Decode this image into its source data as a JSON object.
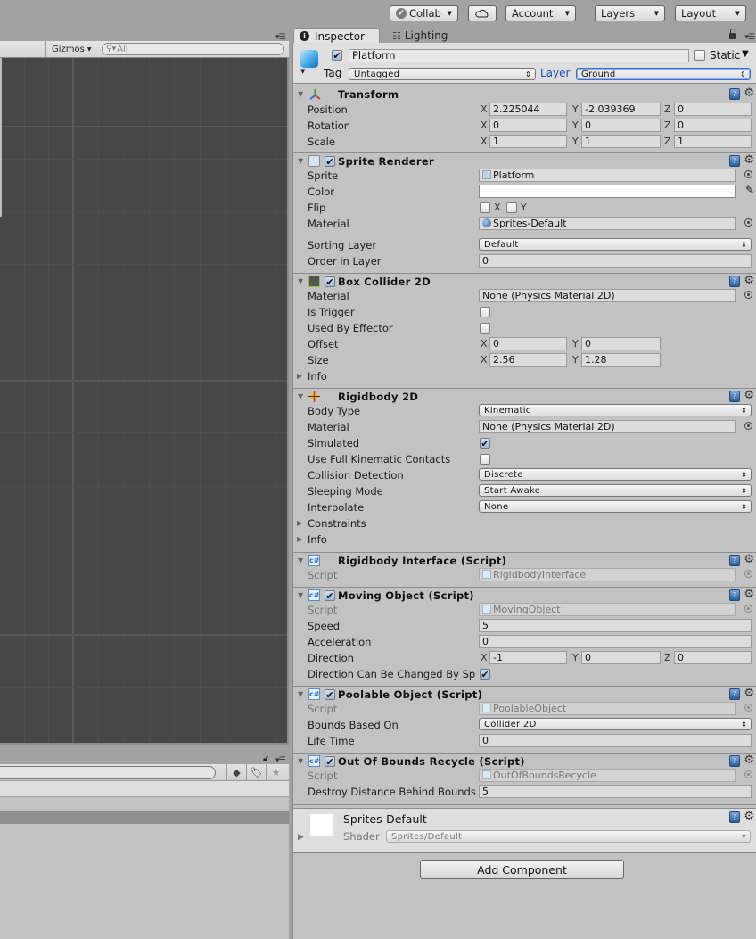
{
  "toolbar": {
    "collab_label": "Collab",
    "cloud_icon": "cloud-icon",
    "account_label": "Account",
    "layers_label": "Layers",
    "layout_label": "Layout"
  },
  "scene": {
    "gizmos_label": "Gizmos",
    "search_placeholder": "All"
  },
  "project": {
    "search_value": "",
    "icons": [
      "filter-by-type-icon",
      "filter-by-label-icon",
      "favorites-star-icon"
    ]
  },
  "inspector": {
    "tabs": [
      {
        "label": "Inspector",
        "icon": "info-icon",
        "active": true
      },
      {
        "label": "Lighting",
        "icon": "lighting-icon",
        "active": false
      }
    ],
    "gameobject": {
      "active": true,
      "name": "Platform",
      "static_label": "Static",
      "static": false,
      "tag_label": "Tag",
      "tag": "Untagged",
      "layer_label": "Layer",
      "layer": "Ground"
    },
    "transform": {
      "title": "Transform",
      "position_label": "Position",
      "rotation_label": "Rotation",
      "scale_label": "Scale",
      "position": {
        "x": "2.225044",
        "y": "-2.039369",
        "z": "0"
      },
      "rotation": {
        "x": "0",
        "y": "0",
        "z": "0"
      },
      "scale": {
        "x": "1",
        "y": "1",
        "z": "1"
      }
    },
    "sprite_renderer": {
      "title": "Sprite Renderer",
      "enabled": true,
      "sprite_label": "Sprite",
      "sprite": "Platform",
      "color_label": "Color",
      "color": "#ffffff",
      "flip_label": "Flip",
      "flip_x_label": "X",
      "flip_y_label": "Y",
      "flip_x": false,
      "flip_y": false,
      "material_label": "Material",
      "material": "Sprites-Default",
      "sorting_layer_label": "Sorting Layer",
      "sorting_layer": "Default",
      "order_label": "Order in Layer",
      "order": "0"
    },
    "box_collider": {
      "title": "Box Collider 2D",
      "enabled": true,
      "material_label": "Material",
      "material": "None (Physics Material 2D)",
      "is_trigger_label": "Is Trigger",
      "is_trigger": false,
      "used_by_effector_label": "Used By Effector",
      "used_by_effector": false,
      "offset_label": "Offset",
      "offset": {
        "x": "0",
        "y": "0"
      },
      "size_label": "Size",
      "size": {
        "x": "2.56",
        "y": "1.28"
      },
      "info_label": "Info"
    },
    "rigidbody": {
      "title": "Rigidbody 2D",
      "body_type_label": "Body Type",
      "body_type": "Kinematic",
      "material_label": "Material",
      "material": "None (Physics Material 2D)",
      "simulated_label": "Simulated",
      "simulated": true,
      "full_kinematic_label": "Use Full Kinematic Contacts",
      "full_kinematic": false,
      "collision_label": "Collision Detection",
      "collision": "Discrete",
      "sleeping_label": "Sleeping Mode",
      "sleeping": "Start Awake",
      "interpolate_label": "Interpolate",
      "interpolate": "None",
      "constraints_label": "Constraints",
      "info_label": "Info"
    },
    "rigidbody_interface": {
      "title": "Rigidbody Interface (Script)",
      "script_label": "Script",
      "script": "RigidbodyInterface"
    },
    "moving_object": {
      "title": "Moving Object (Script)",
      "enabled": true,
      "script_label": "Script",
      "script": "MovingObject",
      "speed_label": "Speed",
      "speed": "5",
      "accel_label": "Acceleration",
      "accel": "0",
      "direction_label": "Direction",
      "direction": {
        "x": "-1",
        "y": "0",
        "z": "0"
      },
      "dir_change_label": "Direction Can Be Changed By Sp",
      "dir_change": true
    },
    "poolable_object": {
      "title": "Poolable Object (Script)",
      "enabled": true,
      "script_label": "Script",
      "script": "PoolableObject",
      "bounds_label": "Bounds Based On",
      "bounds": "Collider 2D",
      "lifetime_label": "Life Time",
      "lifetime": "0"
    },
    "out_of_bounds": {
      "title": "Out Of Bounds Recycle (Script)",
      "enabled": true,
      "script_label": "Script",
      "script": "OutOfBoundsRecycle",
      "distance_label": "Destroy Distance Behind Bounds",
      "distance": "5"
    },
    "material_preview": {
      "name": "Sprites-Default",
      "shader_label": "Shader",
      "shader": "Sprites/Default"
    },
    "add_component_label": "Add Component"
  }
}
